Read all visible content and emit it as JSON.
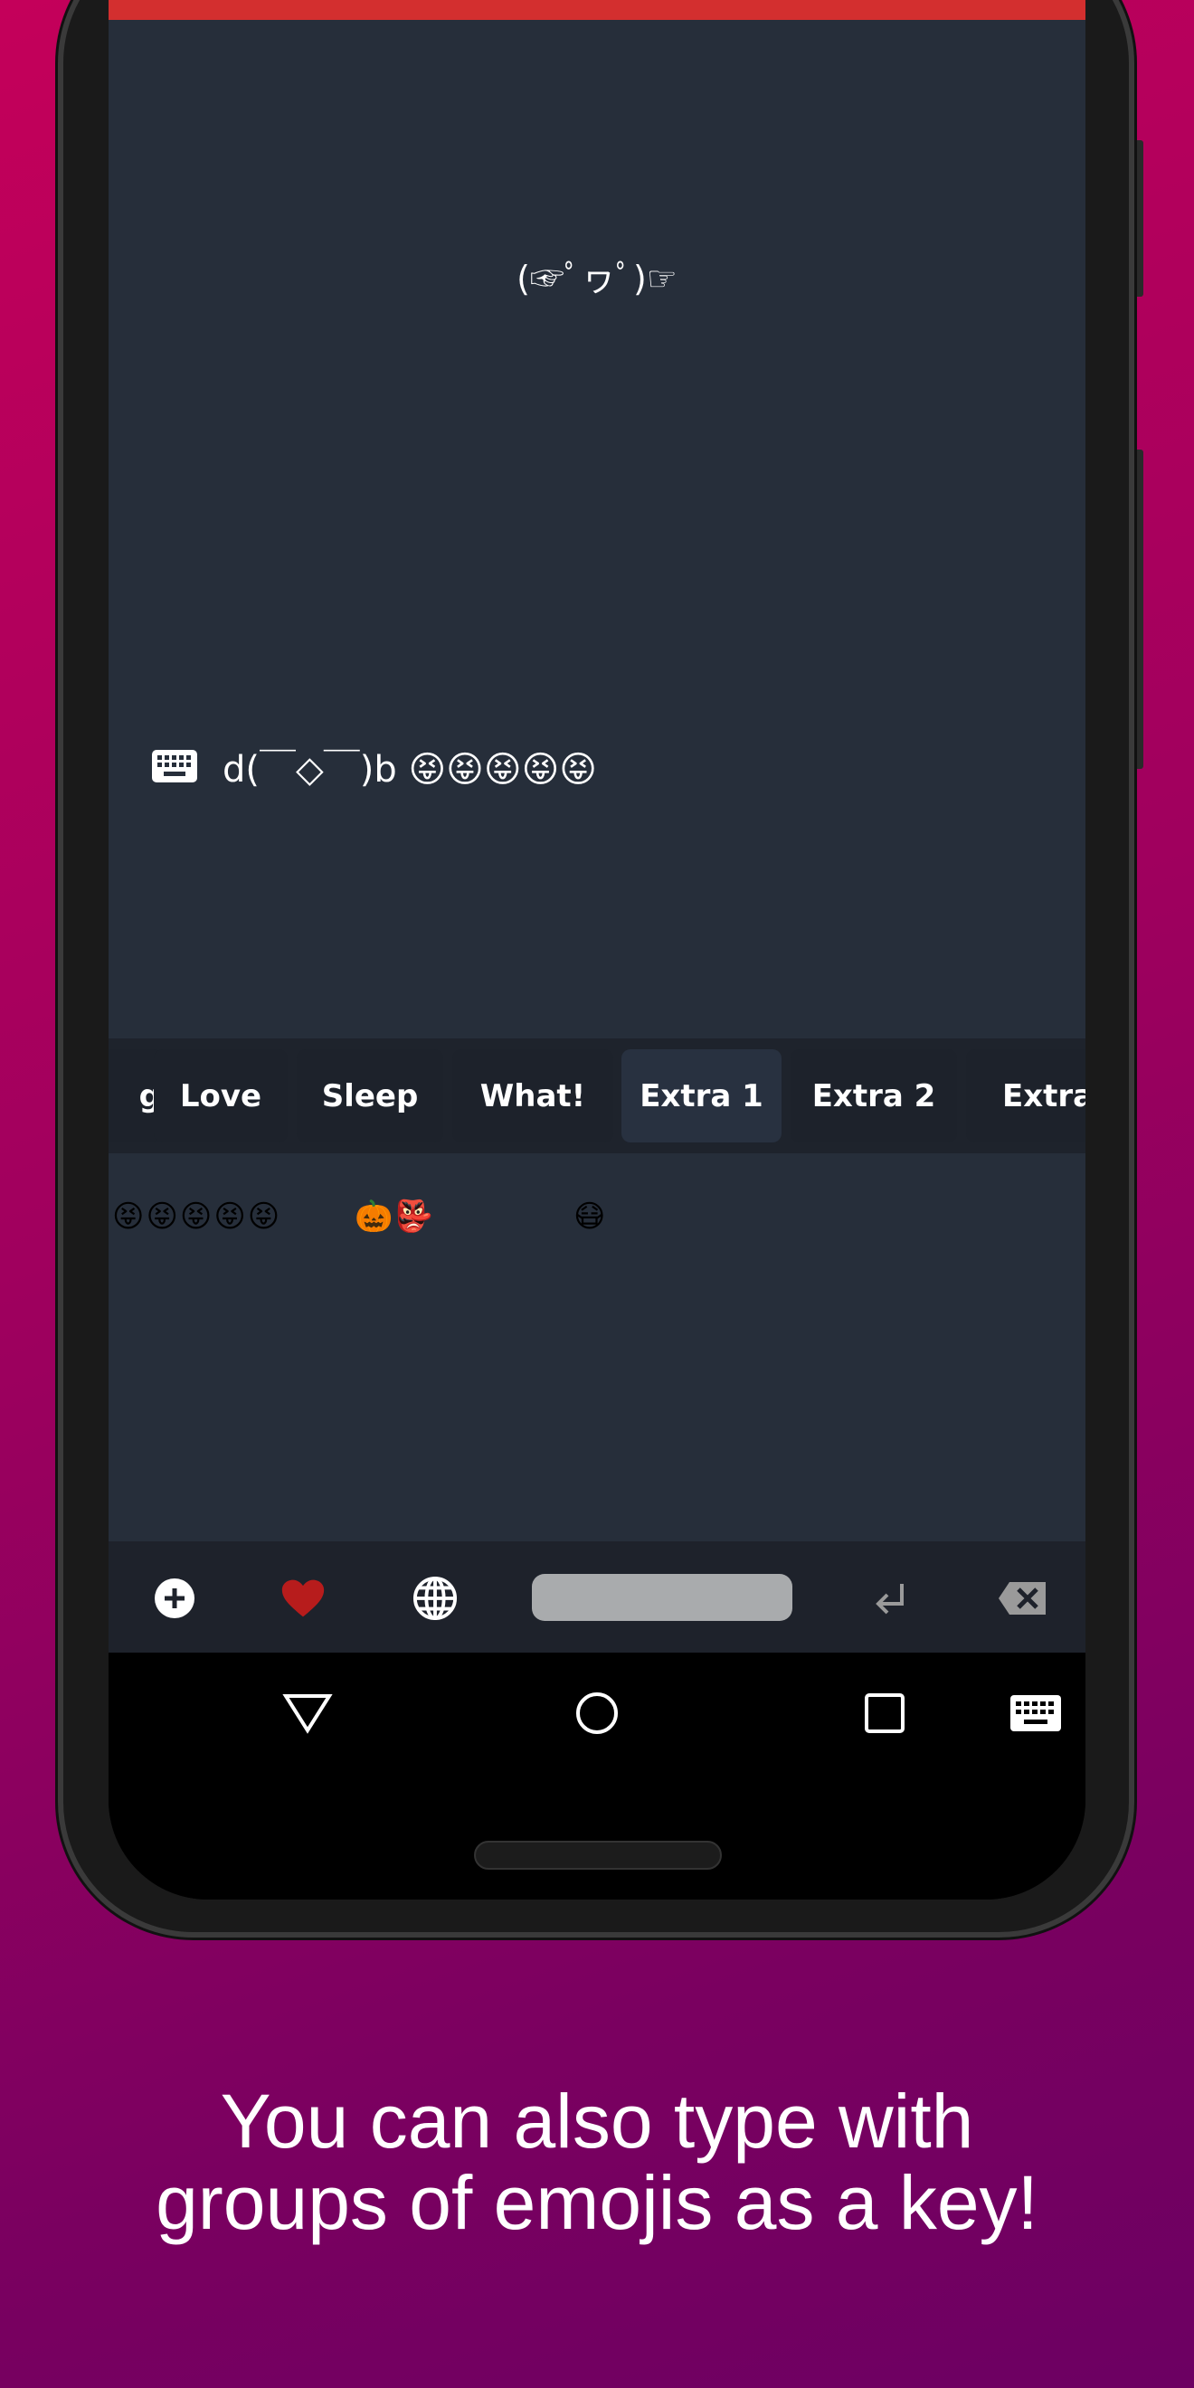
{
  "app": {
    "kaomoji_display": "(☞ﾟヮﾟ)☞",
    "input_text": "d(￣◇￣)b 😝😝😝😝😝"
  },
  "tabs": [
    {
      "label": "g",
      "active": false
    },
    {
      "label": "Love",
      "active": false
    },
    {
      "label": "Sleep",
      "active": false
    },
    {
      "label": "What!",
      "active": false
    },
    {
      "label": "Extra 1",
      "active": true
    },
    {
      "label": "Extra 2",
      "active": false
    },
    {
      "label": "Extra",
      "active": false
    }
  ],
  "emoji_keys": [
    "😝😝😝😝😝",
    "🎃👺",
    "😷"
  ],
  "bottom_bar": {
    "icons": [
      "plus-circle-icon",
      "heart-icon",
      "globe-icon",
      "enter-icon",
      "backspace-icon"
    ],
    "heart_color": "#b71c1c"
  },
  "nav": {
    "icons": [
      "back-icon",
      "home-icon",
      "recents-icon",
      "keyboard-icon"
    ]
  },
  "caption": {
    "line1": "You can also type with",
    "line2": "groups of emojis as a key!"
  },
  "colors": {
    "accent_bar": "#d32f2f",
    "background": "#262e3a",
    "active_tab": "#283140"
  }
}
